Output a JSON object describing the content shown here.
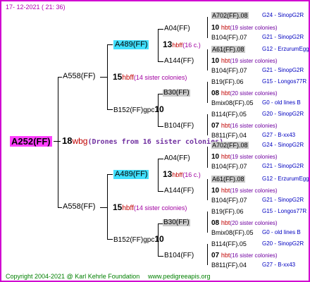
{
  "header": {
    "timestamp": "17- 12-2021 ( 21: 36)"
  },
  "footer": {
    "copyright": "Copyright 2004-2021 @ Karl Kehrle Foundation",
    "website": "www.pedigreeapis.org"
  },
  "colors": {
    "frame": "#d000d0",
    "root_highlight": "#ff40ff",
    "cyan_highlight": "#40e0ff",
    "gray_highlight": "#c8c8c8",
    "tag_red": "#c00000",
    "note_purple": "#a000a0",
    "location_blue": "#0000c0",
    "footer_green": "#008000"
  },
  "root": {
    "id": "A252(FF)",
    "number": "18",
    "tag": "wbg",
    "note": "(Drones from 16 sister colonies)"
  },
  "upper": {
    "parent": {
      "id": "A558(FF)",
      "number": "15",
      "tag": "hbff",
      "note": "(14 sister colonies)"
    },
    "top": {
      "id": "A489(FF)",
      "number": "13",
      "tag": "hbff",
      "note": "(16 c.)"
    },
    "bottom": {
      "id": "B152(FF)gpc",
      "number": "10"
    },
    "g3": [
      "A04(FF)",
      "A144(FF)",
      "B30(FF)",
      "B104(FF)"
    ]
  },
  "lower": {
    "parent": {
      "id": "A558(FF)",
      "number": "15",
      "tag": "hbff",
      "note": "(14 sister colonies)"
    },
    "top": {
      "id": "A489(FF)",
      "number": "13",
      "tag": "hbff",
      "note": "(16 c.)"
    },
    "bottom": {
      "id": "B152(FF)gpc",
      "number": "10"
    },
    "g3": [
      "A04(FF)",
      "A144(FF)",
      "B30(FF)",
      "B104(FF)"
    ]
  },
  "g4": [
    {
      "id": "A702(FF).08",
      "gray": true,
      "info": "G24 - SinopG2R"
    },
    {
      "number": "10",
      "tag": "hbt",
      "note": "(19 sister colonies)"
    },
    {
      "id": "B104(FF).07",
      "info": "G21 - SinopG2R"
    },
    {
      "id": "A61(FF).08",
      "gray": true,
      "info": "G12 - ErzurumEgg8"
    },
    {
      "number": "10",
      "tag": "hbt",
      "note": "(19 sister colonies)"
    },
    {
      "id": "B104(FF).07",
      "info": "G21 - SinopG2R"
    },
    {
      "id": "B19(FF).06",
      "info": "G15 - Longos77R"
    },
    {
      "number": "08",
      "tag": "hbt",
      "note": "(20 sister colonies)"
    },
    {
      "id": "Bmix08(FF).05",
      "info": "G0 - old lines B"
    },
    {
      "id": "B114(FF).05",
      "info": "G20 - SinopG2R"
    },
    {
      "number": "07",
      "tag": "hbt",
      "note": "(16 sister colonies)"
    },
    {
      "id": "B811(FF).04",
      "info": "G27 - B-xx43"
    },
    {
      "id": "A702(FF).08",
      "gray": true,
      "info": "G24 - SinopG2R"
    },
    {
      "number": "10",
      "tag": "hbt",
      "note": "(19 sister colonies)"
    },
    {
      "id": "B104(FF).07",
      "info": "G21 - SinopG2R"
    },
    {
      "id": "A61(FF).08",
      "gray": true,
      "info": "G12 - ErzurumEgg8"
    },
    {
      "number": "10",
      "tag": "hbt",
      "note": "(19 sister colonies)"
    },
    {
      "id": "B104(FF).07",
      "info": "G21 - SinopG2R"
    },
    {
      "id": "B19(FF).06",
      "info": "G15 - Longos77R"
    },
    {
      "number": "08",
      "tag": "hbt",
      "note": "(20 sister colonies)"
    },
    {
      "id": "Bmix08(FF).05",
      "info": "G0 - old lines B"
    },
    {
      "id": "B114(FF).05",
      "info": "G20 - SinopG2R"
    },
    {
      "number": "07",
      "tag": "hbt",
      "note": "(16 sister colonies)"
    },
    {
      "id": "B811(FF).04",
      "info": "G27 - B-xx43"
    }
  ]
}
